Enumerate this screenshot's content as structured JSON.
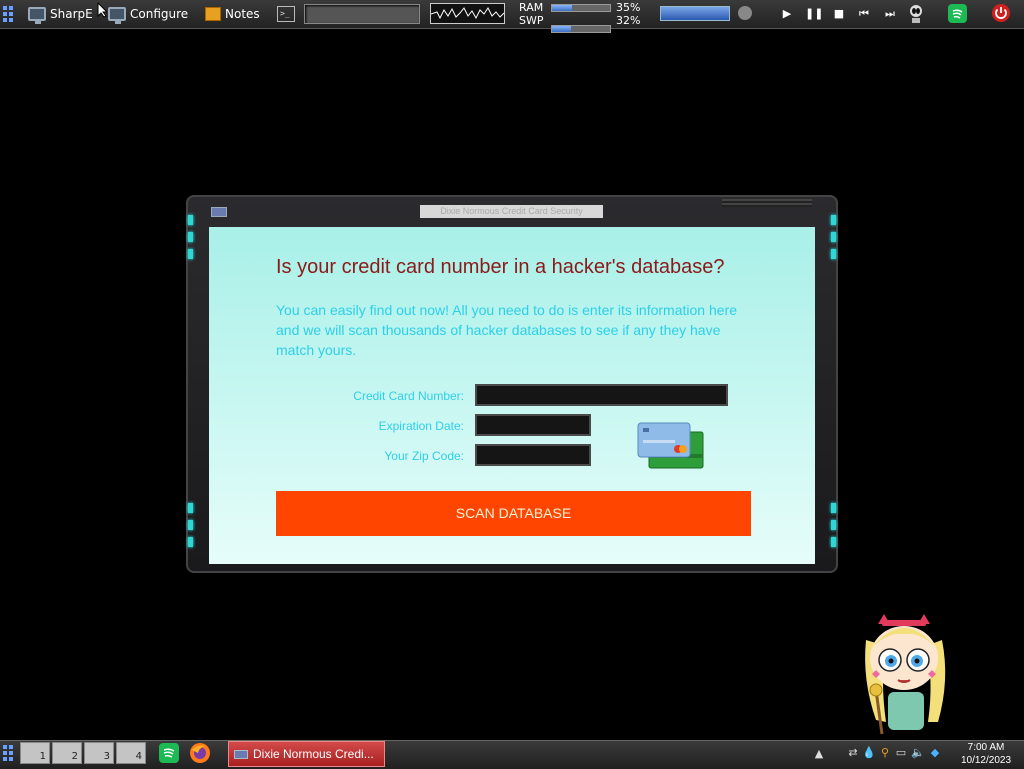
{
  "top_panel": {
    "launchers": [
      {
        "label": "SharpE"
      },
      {
        "label": "Configure"
      },
      {
        "label": "Notes"
      }
    ],
    "memory": {
      "ram_label": "RAM",
      "ram_percent": "35%",
      "ram_fraction": 0.35,
      "swp_label": "SWP",
      "swp_percent": "32%",
      "swp_fraction": 0.32
    }
  },
  "dialog": {
    "window_title": "Dixie Normous Credit Card Security",
    "headline": "Is your credit card number in a hacker's database?",
    "description": "You can easily find out now! All you need to do is enter its information here and we will scan thousands of hacker databases to see if any they have match yours.",
    "fields": {
      "card_number_label": "Credit Card Number:",
      "expiration_label": "Expiration Date:",
      "zip_label": "Your Zip Code:"
    },
    "scan_button_label": "SCAN DATABASE"
  },
  "taskbar": {
    "workspaces": [
      "1",
      "2",
      "3",
      "4"
    ],
    "active_task": "Dixie Normous Credi...",
    "clock_time": "7:00 AM",
    "clock_date": "10/12/2023"
  },
  "colors": {
    "headline": "#8b1a1a",
    "description": "#2ecfe8",
    "scan_button": "#ff4500",
    "dialog_bg": "#a8f0e8"
  }
}
